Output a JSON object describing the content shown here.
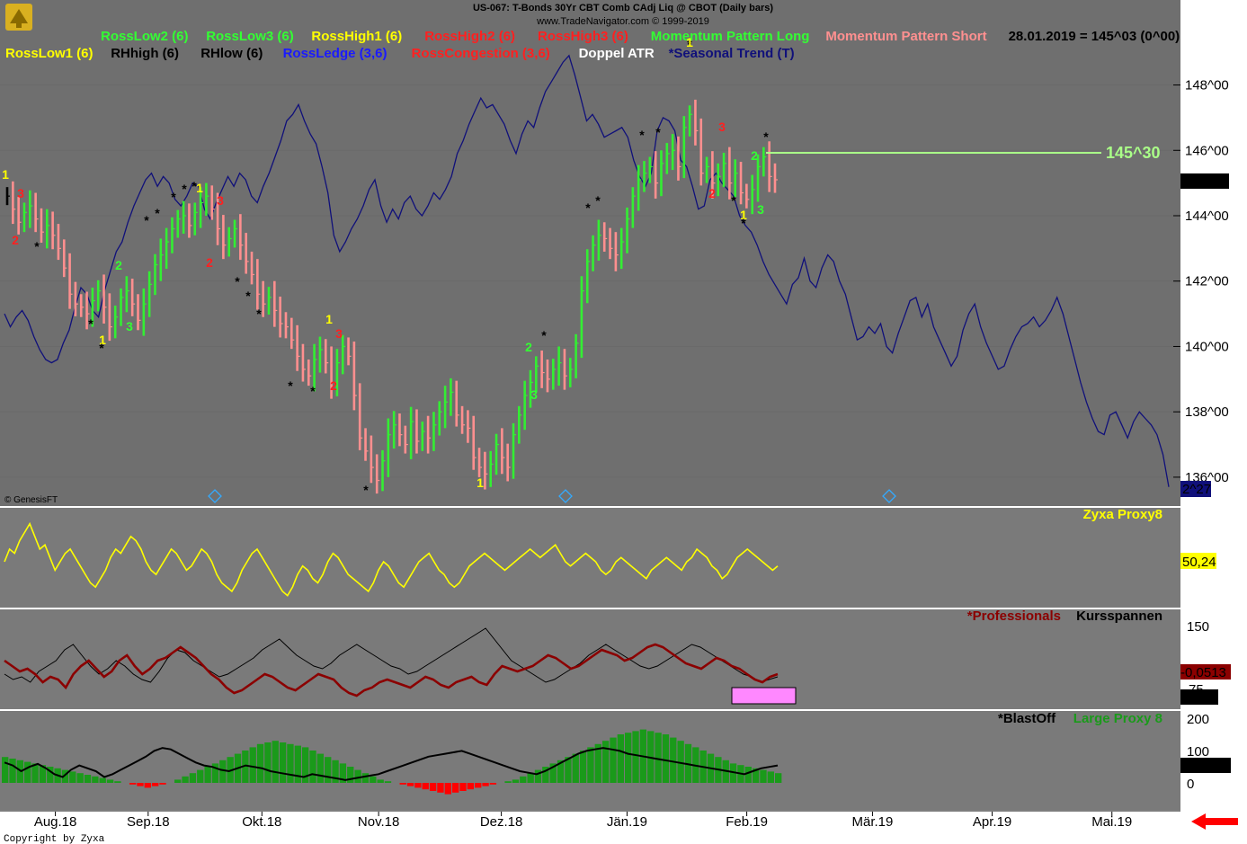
{
  "header": {
    "title": "US-067:  T-Bonds 30Yr CBT Comb CAdj Liq @ CBOT  (Daily bars)",
    "subtitle": "www.TradeNavigator.com © 1999-2019"
  },
  "legend_row1": [
    {
      "text": "RossLow2 (6)",
      "color": "#33ff33"
    },
    {
      "text": "RossLow3 (6)",
      "color": "#33ff33"
    },
    {
      "text": "RossHigh1 (6)",
      "color": "#ffff00"
    },
    {
      "text": "RossHigh2 (6)",
      "color": "#ff2020"
    },
    {
      "text": "RossHigh3 (6)",
      "color": "#ff2020"
    },
    {
      "text": "Momentum Pattern Long",
      "color": "#33ff33"
    },
    {
      "text": "Momentum Pattern Short",
      "color": "#ff9090"
    },
    {
      "text": "28.01.2019 = 145^03 (0^00)",
      "color": "#000000"
    }
  ],
  "legend_row2": [
    {
      "text": "RossLow1 (6)",
      "color": "#ffff00"
    },
    {
      "text": "RHhigh (6)",
      "color": "#000000"
    },
    {
      "text": "RHlow (6)",
      "color": "#000000"
    },
    {
      "text": "RossLedge (3,6)",
      "color": "#1a1aff"
    },
    {
      "text": "RossCongestion (3,6)",
      "color": "#ff2020"
    },
    {
      "text": "Doppel ATR",
      "color": "#ffffff"
    },
    {
      "text": "*Seasonal Trend (T)",
      "color": "#10107a"
    }
  ],
  "copyright_inner": "© GenesisFT",
  "copyright_outer": "Copyright by Zyxa",
  "target_label": "145^30",
  "last_price_label": "145^03",
  "seasonal_end_label": "2^27",
  "colors": {
    "bg": "#7d7d7d",
    "up": "#33ee33",
    "down": "#ff8f8f",
    "neutral": "#000000",
    "seasonal": "#10107a",
    "yellow": "#ffff00",
    "darkred": "#8b0000",
    "green": "#1a9a1a",
    "red": "#ff0000",
    "pink": "#ff88ff"
  },
  "panels": {
    "zyxa": {
      "title": "Zyxa Proxy8",
      "value_label": "50,24",
      "title_color": "#ffff00"
    },
    "prof": {
      "title1": "*Professionals",
      "title2": "Kursspannen",
      "value1": "-0,0513",
      "value2": "70,09",
      "tick_top": "150",
      "tick_mid": "75"
    },
    "blast": {
      "title1": "*BlastOff",
      "title2": "Large Proxy 8",
      "value1": "-0,4785",
      "ticks": [
        "200",
        "100",
        "0"
      ]
    }
  },
  "chart_data": {
    "type": "bar",
    "title": "US-067:  T-Bonds 30Yr CBT Comb CAdj Liq @ CBOT  (Daily bars)",
    "y_ticks": [
      "136^00",
      "138^00",
      "140^00",
      "142^00",
      "144^00",
      "146^00",
      "148^00"
    ],
    "y_tick_values": [
      136,
      138,
      140,
      142,
      144,
      146,
      148
    ],
    "ylim": [
      135.2,
      149.5
    ],
    "x_tick_labels": [
      "Aug.18",
      "Sep.18",
      "Okt.18",
      "Nov.18",
      "Dez.18",
      "Jän.19",
      "Feb.19",
      "Mär.19",
      "Apr.19",
      "Mai.19"
    ],
    "x_tick_index": [
      17,
      48,
      86,
      125,
      166,
      208,
      248,
      290,
      330,
      370
    ],
    "n_days": 390,
    "last_bar_index": 125,
    "price_close": [
      144.6,
      144.2,
      143.8,
      144.1,
      144.3,
      143.9,
      143.5,
      143.7,
      143.4,
      143.0,
      142.4,
      141.6,
      141.3,
      141.2,
      141.0,
      141.4,
      141.7,
      141.2,
      140.6,
      140.9,
      141.5,
      141.7,
      141.3,
      140.8,
      141.3,
      141.9,
      142.5,
      142.8,
      143.2,
      143.6,
      143.9,
      144.0,
      143.7,
      144.1,
      144.4,
      144.6,
      144.2,
      143.6,
      143.1,
      143.3,
      143.6,
      143.1,
      142.6,
      142.2,
      141.6,
      141.3,
      141.5,
      141.1,
      140.7,
      140.6,
      140.2,
      139.7,
      139.3,
      139.1,
      139.6,
      139.9,
      139.5,
      138.9,
      139.5,
      140.0,
      139.7,
      138.5,
      137.2,
      136.8,
      136.3,
      135.9,
      136.5,
      137.3,
      137.6,
      137.3,
      137.0,
      137.7,
      137.1,
      137.4,
      137.2,
      137.6,
      138.0,
      138.3,
      138.6,
      137.9,
      137.6,
      137.5,
      136.6,
      136.3,
      136.1,
      136.4,
      137.0,
      136.6,
      136.3,
      137.3,
      137.9,
      138.5,
      138.9,
      139.4,
      139.2,
      139.0,
      139.3,
      139.5,
      139.1,
      139.3,
      140.1,
      141.7,
      142.6,
      143.1,
      143.4,
      143.3,
      143.0,
      142.8,
      143.2,
      143.9,
      144.6,
      145.1,
      145.3,
      145.5,
      145.0,
      145.6,
      145.9,
      146.0,
      145.5,
      146.7,
      147.1,
      146.6,
      145.3,
      145.5,
      145.0,
      145.2,
      145.6,
      145.0,
      145.3,
      144.7,
      144.5,
      144.8,
      145.5,
      145.8,
      145.2,
      145.1
    ],
    "seasonal_trend": [
      141.0,
      140.6,
      140.9,
      141.1,
      140.8,
      140.3,
      139.9,
      139.6,
      139.5,
      139.6,
      140.1,
      140.5,
      141.2,
      141.8,
      141.6,
      141.1,
      140.9,
      141.7,
      142.3,
      142.9,
      143.2,
      143.8,
      144.3,
      144.7,
      145.1,
      145.3,
      144.9,
      145.2,
      145.0,
      144.5,
      144.3,
      144.6,
      145.0,
      144.9,
      144.2,
      143.9,
      144.4,
      144.8,
      145.2,
      144.9,
      145.3,
      145.1,
      144.6,
      144.4,
      144.9,
      145.3,
      145.8,
      146.3,
      146.9,
      147.1,
      147.4,
      146.9,
      146.5,
      146.2,
      145.5,
      144.7,
      143.4,
      142.9,
      143.2,
      143.6,
      143.9,
      144.3,
      144.8,
      145.1,
      144.3,
      143.8,
      144.2,
      143.9,
      144.4,
      144.6,
      144.2,
      144.0,
      144.3,
      144.7,
      144.5,
      144.8,
      145.2,
      145.9,
      146.3,
      146.8,
      147.2,
      147.6,
      147.3,
      147.4,
      147.1,
      146.8,
      146.3,
      145.9,
      146.5,
      146.9,
      146.7,
      147.3,
      147.8,
      148.1,
      148.4,
      148.7,
      148.9,
      148.3,
      147.6,
      146.9,
      147.1,
      146.8,
      146.4,
      146.5,
      146.6,
      146.7,
      146.4,
      145.7,
      145.2,
      144.9,
      145.3,
      146.6,
      147.0,
      146.9,
      146.6,
      145.7,
      145.5,
      144.9,
      144.2,
      144.3,
      145.1,
      145.3,
      145.0,
      144.8,
      144.6,
      144.0,
      143.7,
      143.5,
      143.1,
      142.6,
      142.2,
      141.9,
      141.6,
      141.3,
      141.9,
      142.1,
      142.7,
      142.0,
      141.8,
      142.4,
      142.8,
      142.6,
      142.0,
      141.6,
      140.9,
      140.2,
      140.3,
      140.6,
      140.4,
      140.7,
      140.0,
      139.8,
      140.4,
      140.9,
      141.4,
      141.5,
      140.9,
      141.3,
      140.6,
      140.2,
      139.8,
      139.4,
      139.7,
      140.5,
      141.0,
      141.3,
      140.6,
      140.1,
      139.7,
      139.3,
      139.4,
      139.9,
      140.3,
      140.6,
      140.7,
      140.9,
      140.6,
      140.8,
      141.1,
      141.5,
      141.0,
      140.3,
      139.6,
      138.9,
      138.3,
      137.8,
      137.4,
      137.3,
      137.9,
      138.0,
      137.6,
      137.2,
      137.7,
      138.0,
      137.8,
      137.6,
      137.3,
      136.7,
      135.7
    ],
    "zyxa_proxy8": [
      55,
      58,
      57,
      60,
      62,
      64,
      61,
      58,
      59,
      56,
      53,
      55,
      57,
      58,
      56,
      54,
      52,
      50,
      49,
      51,
      53,
      56,
      58,
      57,
      59,
      61,
      60,
      58,
      55,
      53,
      52,
      54,
      56,
      58,
      57,
      55,
      53,
      54,
      56,
      58,
      57,
      55,
      52,
      50,
      49,
      48,
      50,
      53,
      55,
      57,
      58,
      56,
      54,
      52,
      50,
      48,
      47,
      49,
      52,
      54,
      53,
      51,
      50,
      52,
      55,
      57,
      56,
      54,
      52,
      51,
      50,
      49,
      48,
      50,
      53,
      55,
      54,
      52,
      50,
      49,
      51,
      53,
      55,
      56,
      57,
      55,
      53,
      52,
      50,
      49,
      50,
      52,
      54,
      55,
      56,
      57,
      56,
      55,
      54,
      53,
      54,
      55,
      56,
      57,
      58,
      57,
      56,
      57,
      58,
      59,
      57,
      55,
      54,
      55,
      56,
      57,
      56,
      55,
      53,
      52,
      53,
      55,
      56,
      55,
      54,
      53,
      52,
      51,
      53,
      54,
      55,
      56,
      55,
      54,
      53,
      55,
      56,
      58,
      57,
      56,
      54,
      53,
      51,
      52,
      54,
      56,
      57,
      58,
      57,
      56,
      55,
      54,
      53,
      54
    ],
    "professionals": [
      60,
      58,
      56,
      57,
      55,
      52,
      54,
      53,
      50,
      55,
      58,
      60,
      57,
      54,
      56,
      60,
      62,
      58,
      55,
      57,
      60,
      61,
      63,
      65,
      63,
      61,
      58,
      55,
      53,
      50,
      48,
      49,
      51,
      53,
      55,
      54,
      52,
      50,
      49,
      51,
      53,
      55,
      54,
      53,
      50,
      48,
      47,
      49,
      50,
      52,
      53,
      52,
      51,
      50,
      52,
      54,
      53,
      51,
      50,
      52,
      53,
      54,
      52,
      51,
      55,
      58,
      57,
      56,
      57,
      58,
      60,
      62,
      61,
      59,
      57,
      58,
      60,
      62,
      64,
      63,
      62,
      60,
      61,
      63,
      65,
      66,
      65,
      63,
      61,
      59,
      58,
      57,
      59,
      61,
      60,
      58,
      57,
      55,
      53,
      52,
      54,
      55
    ],
    "kursspannen": [
      55,
      53,
      54,
      52,
      56,
      58,
      60,
      64,
      66,
      62,
      58,
      55,
      57,
      60,
      58,
      55,
      53,
      52,
      56,
      61,
      64,
      63,
      60,
      58,
      56,
      54,
      55,
      57,
      59,
      61,
      64,
      66,
      68,
      65,
      62,
      60,
      58,
      57,
      59,
      62,
      64,
      66,
      64,
      62,
      60,
      58,
      57,
      55,
      56,
      58,
      60,
      62,
      64,
      66,
      68,
      70,
      72,
      68,
      64,
      60,
      58,
      56,
      54,
      52,
      53,
      55,
      57,
      59,
      62,
      64,
      66,
      64,
      62,
      60,
      58,
      57,
      58,
      60,
      62,
      64,
      66,
      65,
      63,
      61,
      59,
      57,
      55,
      54,
      52,
      53,
      54
    ],
    "blastoff": [
      70,
      60,
      40,
      55,
      65,
      50,
      30,
      20,
      45,
      60,
      50,
      40,
      20,
      30,
      45,
      60,
      75,
      90,
      110,
      120,
      115,
      100,
      85,
      70,
      60,
      55,
      45,
      40,
      50,
      60,
      55,
      50,
      40,
      35,
      30,
      25,
      20,
      30,
      25,
      20,
      15,
      10,
      15,
      20,
      25,
      30,
      40,
      50,
      60,
      70,
      80,
      90,
      95,
      100,
      105,
      110,
      100,
      90,
      80,
      70,
      60,
      50,
      40,
      35,
      30,
      40,
      55,
      70,
      85,
      100,
      110,
      115,
      120,
      115,
      110,
      100,
      95,
      90,
      85,
      80,
      75,
      70,
      65,
      60,
      55,
      50,
      45,
      40,
      35,
      30,
      40,
      50,
      55,
      60
    ],
    "large_proxy8": [
      80,
      75,
      70,
      65,
      60,
      55,
      50,
      45,
      40,
      35,
      30,
      25,
      20,
      15,
      10,
      5,
      0,
      -5,
      -10,
      -15,
      -10,
      -5,
      0,
      10,
      20,
      30,
      40,
      50,
      60,
      70,
      80,
      90,
      100,
      110,
      120,
      125,
      130,
      125,
      120,
      115,
      110,
      100,
      90,
      80,
      70,
      60,
      50,
      40,
      30,
      20,
      10,
      5,
      0,
      -5,
      -10,
      -15,
      -20,
      -25,
      -30,
      -35,
      -30,
      -25,
      -20,
      -15,
      -10,
      -5,
      0,
      5,
      10,
      20,
      30,
      40,
      50,
      60,
      70,
      80,
      90,
      100,
      110,
      120,
      130,
      140,
      150,
      155,
      160,
      165,
      160,
      155,
      150,
      140,
      130,
      120,
      110,
      100,
      90,
      80,
      70,
      60,
      55,
      50,
      45,
      40,
      35,
      30
    ]
  }
}
